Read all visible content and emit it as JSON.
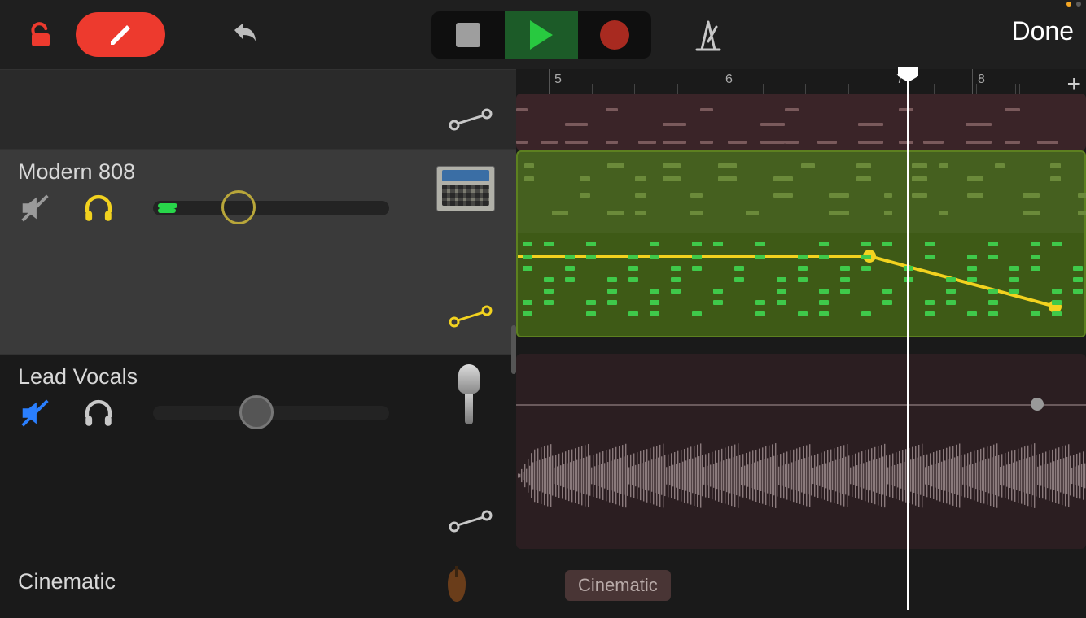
{
  "toolbar": {
    "done_label": "Done",
    "status_dot_colors": [
      "#f5a623",
      "#5c5c5c"
    ]
  },
  "ruler": {
    "bars": [
      5,
      6,
      7,
      8
    ],
    "playhead_bar": 7.3
  },
  "tracks": [
    {
      "name": "Modern 808",
      "muted": true,
      "solo": true,
      "selected": true,
      "volume_pct": 35,
      "instrument": "drum-machine",
      "automation_active": true,
      "automation_points": [
        {
          "bar": 4.0,
          "value": 0.55
        },
        {
          "bar": 7.05,
          "value": 0.55
        },
        {
          "bar": 8.5,
          "value": 0.18
        }
      ]
    },
    {
      "name": "Lead Vocals",
      "muted": true,
      "solo": false,
      "selected": false,
      "volume_pct": 42,
      "instrument": "microphone",
      "automation_active": false,
      "automation_points": [
        {
          "bar": 8.3,
          "value": 0.5
        }
      ]
    },
    {
      "name": "Cinematic",
      "muted": false,
      "solo": false,
      "selected": false,
      "instrument": "strings",
      "region_label": "Cinematic"
    }
  ],
  "colors": {
    "accent_red": "#ed3a2e",
    "accent_green": "#28c940",
    "accent_yellow": "#f2d21f",
    "accent_blue": "#2a7fff"
  }
}
